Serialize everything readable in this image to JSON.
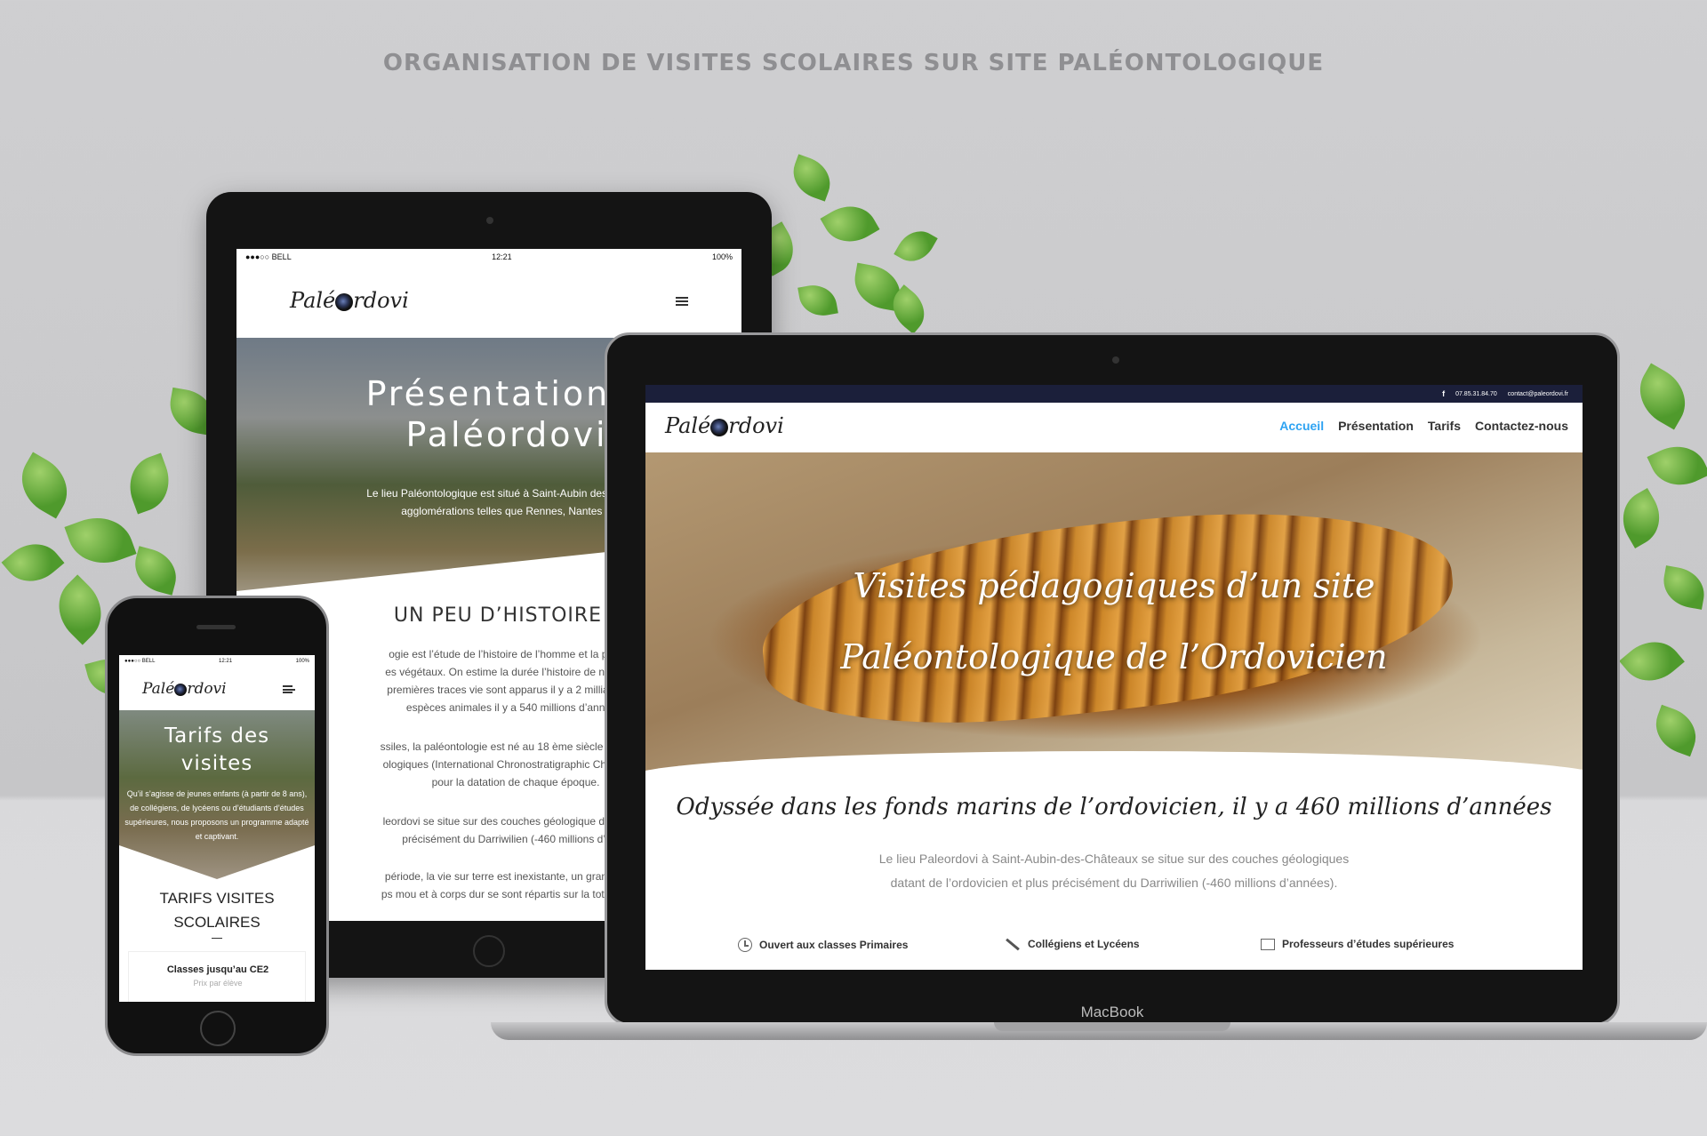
{
  "banner": {
    "title": "ORGANISATION DE VISITES SCOLAIRES SUR SITE PALÉONTOLOGIQUE"
  },
  "tablet": {
    "status": {
      "carrier": "●●●○○ BELL",
      "time": "12:21",
      "battery": "100%"
    },
    "logo": {
      "part1": "Palé",
      "part2": "rdovi"
    },
    "menu_icon": "hamburger-icon",
    "hero": {
      "title_line1": "Présentation d",
      "title_line2": "Paléordovi",
      "text_line1": "Le lieu Paléontologique est situé à Saint-Aubin des Châteaux p",
      "text_line2": "agglomérations telles que Rennes, Nantes où Ar"
    },
    "section_title": "UN PEU D’HISTOIRE",
    "paragraphs": [
      "ogie est l’étude de l’histoire de l’homme et la paléonto",
      "es végétaux. On estime la durée l’histoire de notre plan",
      "premières traces vie sont apparus il y a 2 milliards d’ar",
      "espèces animales il y a 540 millions d’années.",
      "ssiles, la paléontologie est né au 18 ème siècle et à perm",
      "ologiques (International Chronostratigraphic Chart) nous",
      "pour la datation de chaque époque.",
      "leordovi se situe sur des couches géologique datant de l",
      "précisément du Darriwilien (-460 millions d’anné",
      "période, la vie sur terre est inexistante, un grand nombr",
      "ps mou et à corps dur se sont répartis sur la totalité des t"
    ]
  },
  "laptop": {
    "brand_label": "MacBook",
    "topbar": {
      "facebook": "f",
      "phone": "07.85.31.84.70",
      "email": "contact@paleordovi.fr"
    },
    "logo": {
      "part1": "Palé",
      "part2": "rdovi"
    },
    "menu": [
      "Accueil",
      "Présentation",
      "Tarifs",
      "Contactez-nous"
    ],
    "hero_title": "Visites pédagogiques d’un site Paléontologique de l’Ordovicien",
    "subtitle": "Odyssée dans les fonds marins de l’ordovicien, il y a 460 millions d’années",
    "paragraph": "Le lieu Paleordovi à Saint-Aubin-des-Châteaux se situe sur des couches géologiques datant de l’ordovicien et plus précisément du Darriwilien (-460 millions d’années).",
    "features": [
      {
        "icon": "clock-icon",
        "label": "Ouvert aux classes Primaires"
      },
      {
        "icon": "pencil-icon",
        "label": "Collégiens et Lycéens"
      },
      {
        "icon": "presentation-icon",
        "label": "Professeurs d’études supérieures"
      }
    ],
    "accent_color": "#2ea3f2"
  },
  "phone": {
    "status": {
      "carrier": "●●●○○ BELL",
      "time": "12:21",
      "battery": "100%"
    },
    "logo": {
      "part1": "Palé",
      "part2": "rdovi"
    },
    "hero": {
      "title_line1": "Tarifs des",
      "title_line2": "visites",
      "text": "Qu’il s’agisse de jeunes enfants (à partir de 8 ans), de collégiens, de lycéens ou d’étudiants d’études supérieures, nous proposons un programme adapté et captivant."
    },
    "section_title_line1": "TARIFS VISITES",
    "section_title_line2": "SCOLAIRES",
    "card": {
      "title": "Classes jusqu’au CE2",
      "subtitle": "Prix par élève"
    }
  }
}
